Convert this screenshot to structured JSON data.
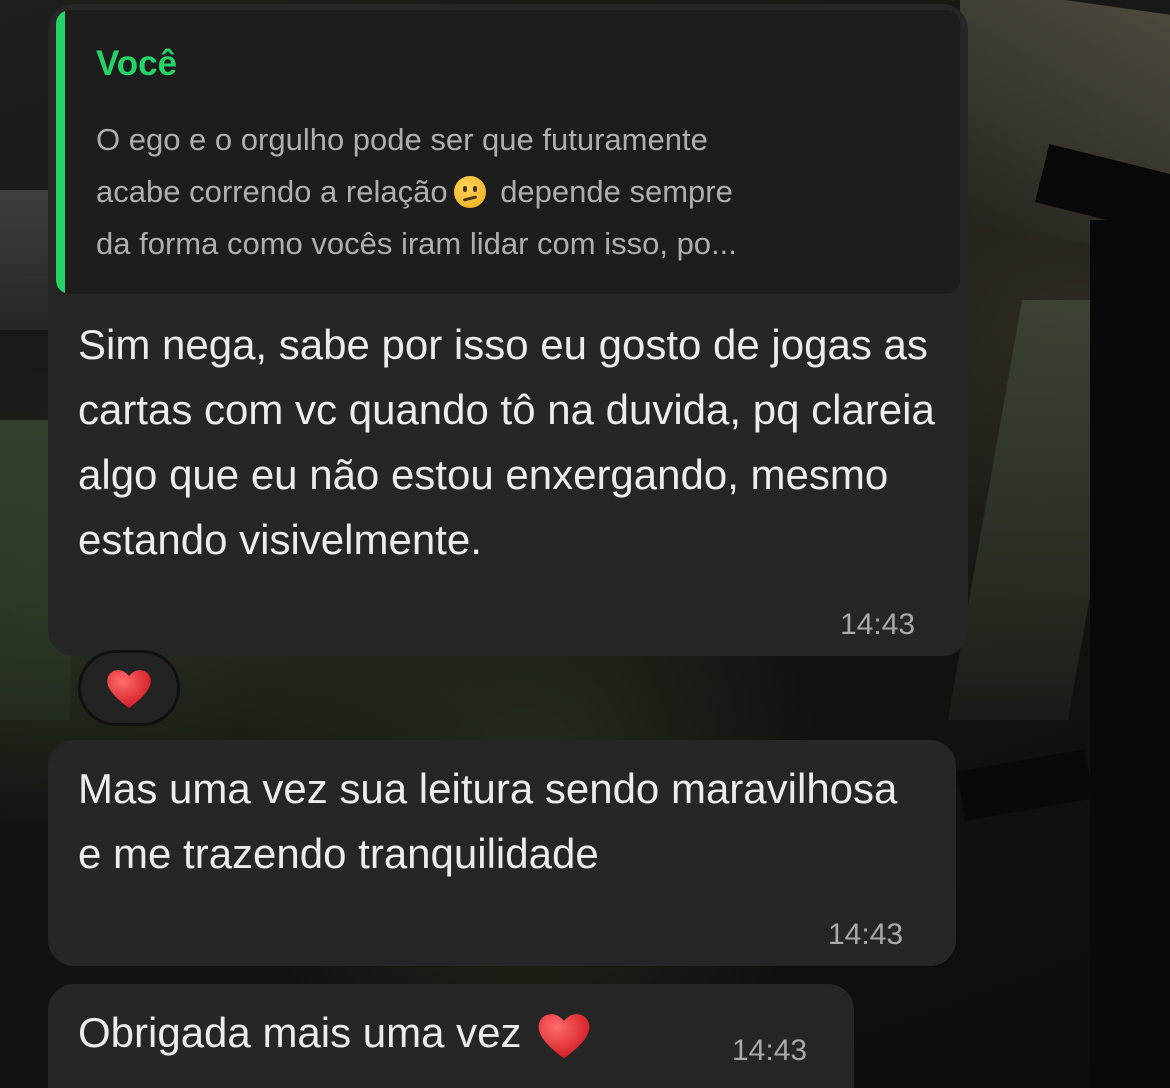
{
  "conversation": {
    "quoted_message": {
      "author": "Você",
      "line1": "O ego e o orgulho pode ser que futuramente",
      "line2_before": "acabe correndo a relação",
      "emoji": "face-with-diagonal-mouth",
      "line2_after": " depende sempre",
      "line3": "da forma como vocês iram lidar com isso, po..."
    },
    "messages": [
      {
        "text": "Sim nega, sabe por isso eu gosto de jogas as cartas com vc quando tô na duvida, pq clareia algo que eu não estou enxergando, mesmo estando visivelmente.",
        "time": "14:43",
        "reaction": "heart-emoji"
      },
      {
        "text": "Mas uma vez sua leitura sendo maravilhosa e me trazendo tranquilidade",
        "time": "14:43"
      },
      {
        "text": "Obrigada mais uma vez",
        "emoji": "heart-emoji",
        "time": "14:43"
      }
    ]
  },
  "colors": {
    "accent_green": "#25d366",
    "bubble_bg": "#262626",
    "quote_bg": "#1d1d1d",
    "heart_red": "#e8262c"
  }
}
